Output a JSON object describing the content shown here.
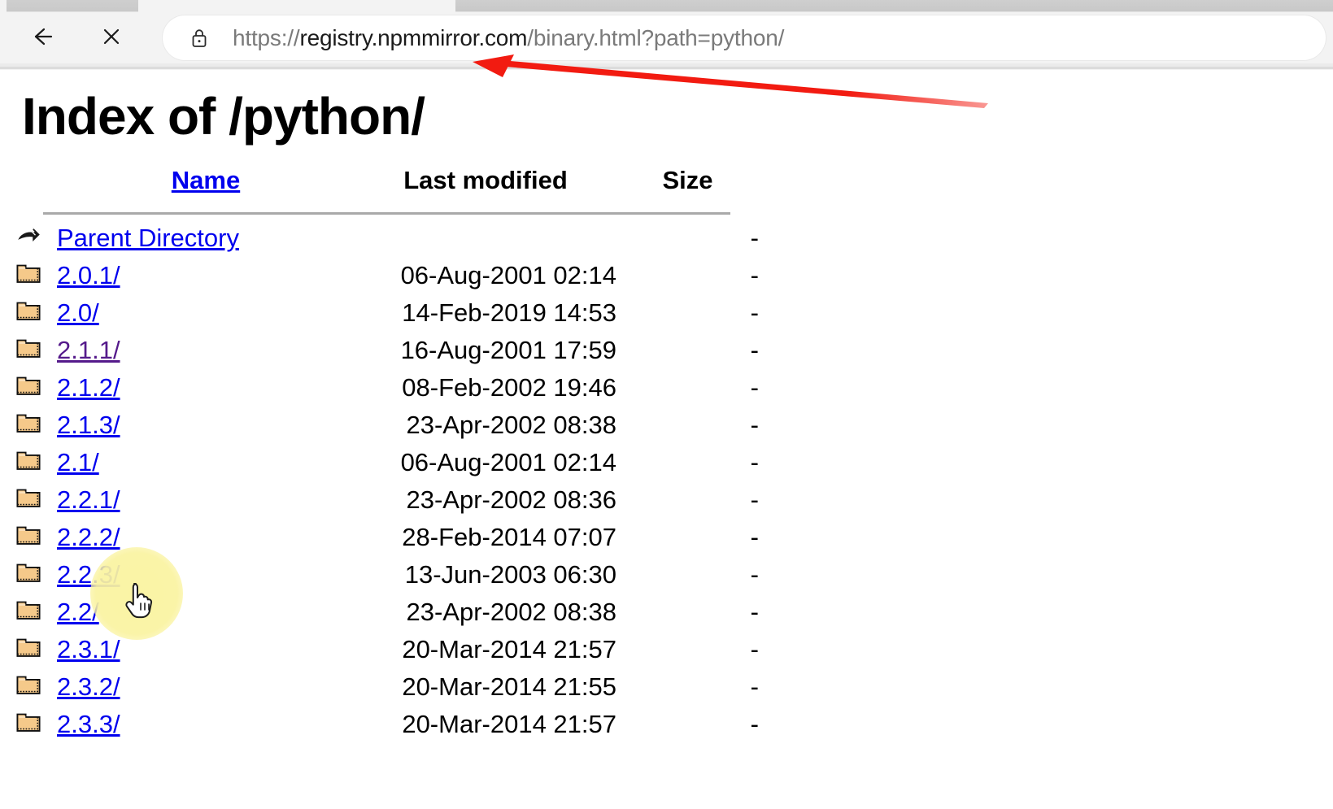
{
  "browser": {
    "back_button_label": "Back",
    "stop_button_label": "Stop",
    "lock_icon": "lock-icon",
    "url_scheme": "https://",
    "url_host": "registry.npmmirror.com",
    "url_path": "/binary.html?path=python/",
    "url_full": "https://registry.npmmirror.com/binary.html?path=python/"
  },
  "page": {
    "title": "Index of /python/",
    "headers": {
      "name": "Name",
      "last_modified": "Last modified",
      "size": "Size"
    },
    "rows": [
      {
        "icon": "back-arrow-icon",
        "name": "Parent Directory",
        "link": true,
        "visited": false,
        "date": "",
        "size": "-"
      },
      {
        "icon": "folder-icon",
        "name": "2.0.1/",
        "link": true,
        "visited": false,
        "date": "06-Aug-2001 02:14",
        "size": "-"
      },
      {
        "icon": "folder-icon",
        "name": "2.0/",
        "link": true,
        "visited": false,
        "date": "14-Feb-2019 14:53",
        "size": "-"
      },
      {
        "icon": "folder-icon",
        "name": "2.1.1/",
        "link": true,
        "visited": true,
        "date": "16-Aug-2001 17:59",
        "size": "-"
      },
      {
        "icon": "folder-icon",
        "name": "2.1.2/",
        "link": true,
        "visited": false,
        "date": "08-Feb-2002 19:46",
        "size": "-"
      },
      {
        "icon": "folder-icon",
        "name": "2.1.3/",
        "link": true,
        "visited": false,
        "date": "23-Apr-2002 08:38",
        "size": "-"
      },
      {
        "icon": "folder-icon",
        "name": "2.1/",
        "link": true,
        "visited": false,
        "date": "06-Aug-2001 02:14",
        "size": "-"
      },
      {
        "icon": "folder-icon",
        "name": "2.2.1/",
        "link": true,
        "visited": false,
        "date": "23-Apr-2002 08:36",
        "size": "-"
      },
      {
        "icon": "folder-icon",
        "name": "2.2.2/",
        "link": true,
        "visited": false,
        "date": "28-Feb-2014 07:07",
        "size": "-"
      },
      {
        "icon": "folder-icon",
        "name": "2.2.3/",
        "link": true,
        "visited": false,
        "date": "13-Jun-2003 06:30",
        "size": "-"
      },
      {
        "icon": "folder-icon",
        "name": "2.2/",
        "link": true,
        "visited": false,
        "date": "23-Apr-2002 08:38",
        "size": "-"
      },
      {
        "icon": "folder-icon",
        "name": "2.3.1/",
        "link": true,
        "visited": false,
        "date": "20-Mar-2014 21:57",
        "size": "-"
      },
      {
        "icon": "folder-icon",
        "name": "2.3.2/",
        "link": true,
        "visited": false,
        "date": "20-Mar-2014 21:55",
        "size": "-"
      },
      {
        "icon": "folder-icon",
        "name": "2.3.3/",
        "link": true,
        "visited": false,
        "date": "20-Mar-2014 21:57",
        "size": "-"
      }
    ]
  },
  "annotations": {
    "arrow_color": "#f21b11",
    "arrow_target": "address-bar",
    "click_highlight_color": "#faf3a0",
    "click_highlight_target": "2.2.1/",
    "cursor_type": "pointer-hand"
  },
  "colors": {
    "link": "#0000ee",
    "link_visited": "#551a8b",
    "chrome_background": "#f3f3f3",
    "page_background": "#ffffff",
    "folder_icon": "#f5c98a"
  }
}
